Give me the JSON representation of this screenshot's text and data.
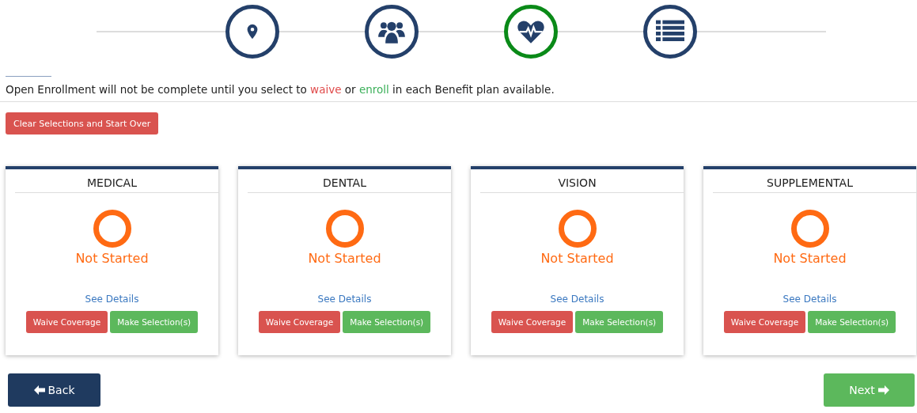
{
  "steps": [
    {
      "kind": "location",
      "selected": false
    },
    {
      "kind": "people",
      "selected": false
    },
    {
      "kind": "heart",
      "selected": true
    },
    {
      "kind": "list",
      "selected": false
    }
  ],
  "notice": [
    {
      "kind": "plain",
      "text": "Open Enrollment will not be complete until you select to "
    },
    {
      "kind": "waive",
      "text": "waive"
    },
    {
      "kind": "plain",
      "text": " or "
    },
    {
      "kind": "enroll",
      "text": "enroll"
    },
    {
      "kind": "plain",
      "text": " in each Benefit plan available."
    }
  ],
  "clear_button": "Clear Selections and Start Over",
  "cards": [
    {
      "title": "MEDICAL",
      "status": "Not Started",
      "details_link": "See Details",
      "waive_button": "Waive Coverage",
      "select_button": "Make Selection(s)"
    },
    {
      "title": "DENTAL",
      "status": "Not Started",
      "details_link": "See Details",
      "waive_button": "Waive Coverage",
      "select_button": "Make Selection(s)"
    },
    {
      "title": "VISION",
      "status": "Not Started",
      "details_link": "See Details",
      "waive_button": "Waive Coverage",
      "select_button": "Make Selection(s)"
    },
    {
      "title": "SUPPLEMENTAL",
      "status": "Not Started",
      "details_link": "See Details",
      "waive_button": "Waive Coverage",
      "select_button": "Make Selection(s)"
    }
  ],
  "back_button": "Back",
  "next_button": "Next"
}
